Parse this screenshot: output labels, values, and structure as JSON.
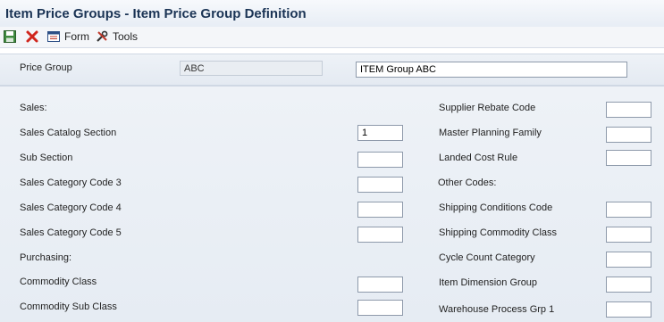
{
  "window": {
    "title": "Item Price Groups - Item Price Group Definition"
  },
  "toolbar": {
    "save_icon": "save-icon",
    "cancel_icon": "close-icon",
    "form_label": "Form",
    "tools_label": "Tools"
  },
  "header": {
    "price_group_label": "Price Group",
    "price_group_value": "ABC",
    "description_value": "ITEM Group ABC"
  },
  "left_column": {
    "sales_heading": "Sales:",
    "sales_catalog_section_label": "Sales Catalog Section",
    "sales_catalog_section_value": "1",
    "sub_section_label": "Sub Section",
    "sub_section_value": "",
    "sales_category_code_3_label": "Sales Category Code 3",
    "sales_category_code_3_value": "",
    "sales_category_code_4_label": "Sales Category Code 4",
    "sales_category_code_4_value": "",
    "sales_category_code_5_label": "Sales Category Code 5",
    "sales_category_code_5_value": "",
    "purchasing_heading": "Purchasing:",
    "commodity_class_label": "Commodity Class",
    "commodity_class_value": "",
    "commodity_sub_class_label": "Commodity Sub Class",
    "commodity_sub_class_value": ""
  },
  "right_column": {
    "supplier_rebate_code_label": "Supplier Rebate Code",
    "supplier_rebate_code_value": "",
    "master_planning_family_label": "Master Planning Family",
    "master_planning_family_value": "",
    "landed_cost_rule_label": "Landed Cost Rule",
    "landed_cost_rule_value": "",
    "other_codes_heading": "Other Codes:",
    "shipping_conditions_code_label": "Shipping Conditions Code",
    "shipping_conditions_code_value": "",
    "shipping_commodity_class_label": "Shipping Commodity Class",
    "shipping_commodity_class_value": "",
    "cycle_count_category_label": "Cycle Count Category",
    "cycle_count_category_value": "",
    "item_dimension_group_label": "Item Dimension Group",
    "item_dimension_group_value": "",
    "warehouse_process_grp_1_label": "Warehouse Process Grp 1",
    "warehouse_process_grp_1_value": ""
  },
  "colors": {
    "title_text": "#1b3455",
    "panel_bg": "#eaeff5",
    "border": "#8e9aab"
  }
}
